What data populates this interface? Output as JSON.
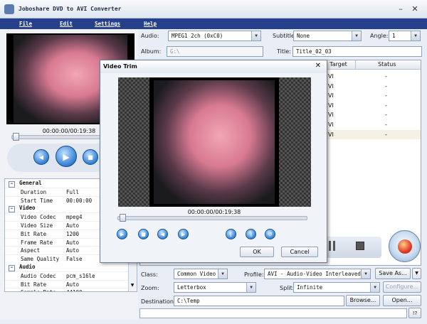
{
  "window": {
    "title": "Joboshare DVD to AVI Converter"
  },
  "menu": [
    "File",
    "Edit",
    "Settings",
    "Help"
  ],
  "top": {
    "audio_label": "Audio:",
    "audio_value": "MPEG1 2ch (0xC0)",
    "subtitle_label": "Subtitle:",
    "subtitle_value": "None",
    "angle_label": "Angle:",
    "angle_value": "1",
    "album_label": "Album:",
    "album_value": "G:\\",
    "title_label": "Title:",
    "title_value": "Title_02_03"
  },
  "list": {
    "headers": [
      "Target",
      "Status"
    ],
    "rows": [
      {
        "target": "VI",
        "status": "-"
      },
      {
        "target": "VI",
        "status": "-"
      },
      {
        "target": "VI",
        "status": "-"
      },
      {
        "target": "VI",
        "status": "-"
      },
      {
        "target": "VI",
        "status": "-"
      },
      {
        "target": "VI",
        "status": "-"
      },
      {
        "target": "VI",
        "status": "-"
      }
    ]
  },
  "preview": {
    "time": "00:00:00/00:19:38"
  },
  "properties": {
    "groups": [
      {
        "name": "General",
        "rows": [
          {
            "k": "Duration",
            "v": "Full"
          },
          {
            "k": "Start Time",
            "v": "00:00:00"
          }
        ]
      },
      {
        "name": "Video",
        "rows": [
          {
            "k": "Video Codec",
            "v": "mpeg4"
          },
          {
            "k": "Video Size",
            "v": "Auto"
          },
          {
            "k": "Bit Rate",
            "v": "1200"
          },
          {
            "k": "Frame Rate",
            "v": "Auto"
          },
          {
            "k": "Aspect",
            "v": "Auto"
          },
          {
            "k": "Same Quality",
            "v": "False"
          }
        ]
      },
      {
        "name": "Audio",
        "rows": [
          {
            "k": "Audio Codec",
            "v": "pcm_s16le"
          },
          {
            "k": "Bit Rate",
            "v": "Auto"
          },
          {
            "k": "Sample Rate",
            "v": "44100"
          }
        ]
      }
    ]
  },
  "bottom": {
    "class_label": "Class:",
    "class_value": "Common Video",
    "profile_label": "Profile:",
    "profile_value": "AVI - Audio-Video Interleaved",
    "saveas": "Save As...",
    "zoom_label": "Zoom:",
    "zoom_value": "Letterbox",
    "split_label": "Split:",
    "split_value": "Infinite",
    "configure": "Configure...",
    "dest_label": "Destination:",
    "dest_value": "C:\\Temp",
    "browse": "Browse...",
    "open": "Open...",
    "help_btn": "!?"
  },
  "dialog": {
    "title": "Video Trim",
    "time": "00:00:00/00:19:38",
    "ok": "OK",
    "cancel": "Cancel"
  },
  "colors": {
    "menu_bg": "#26408c",
    "accent_blue": "#3b86d8",
    "record_red": "#e23a24"
  }
}
